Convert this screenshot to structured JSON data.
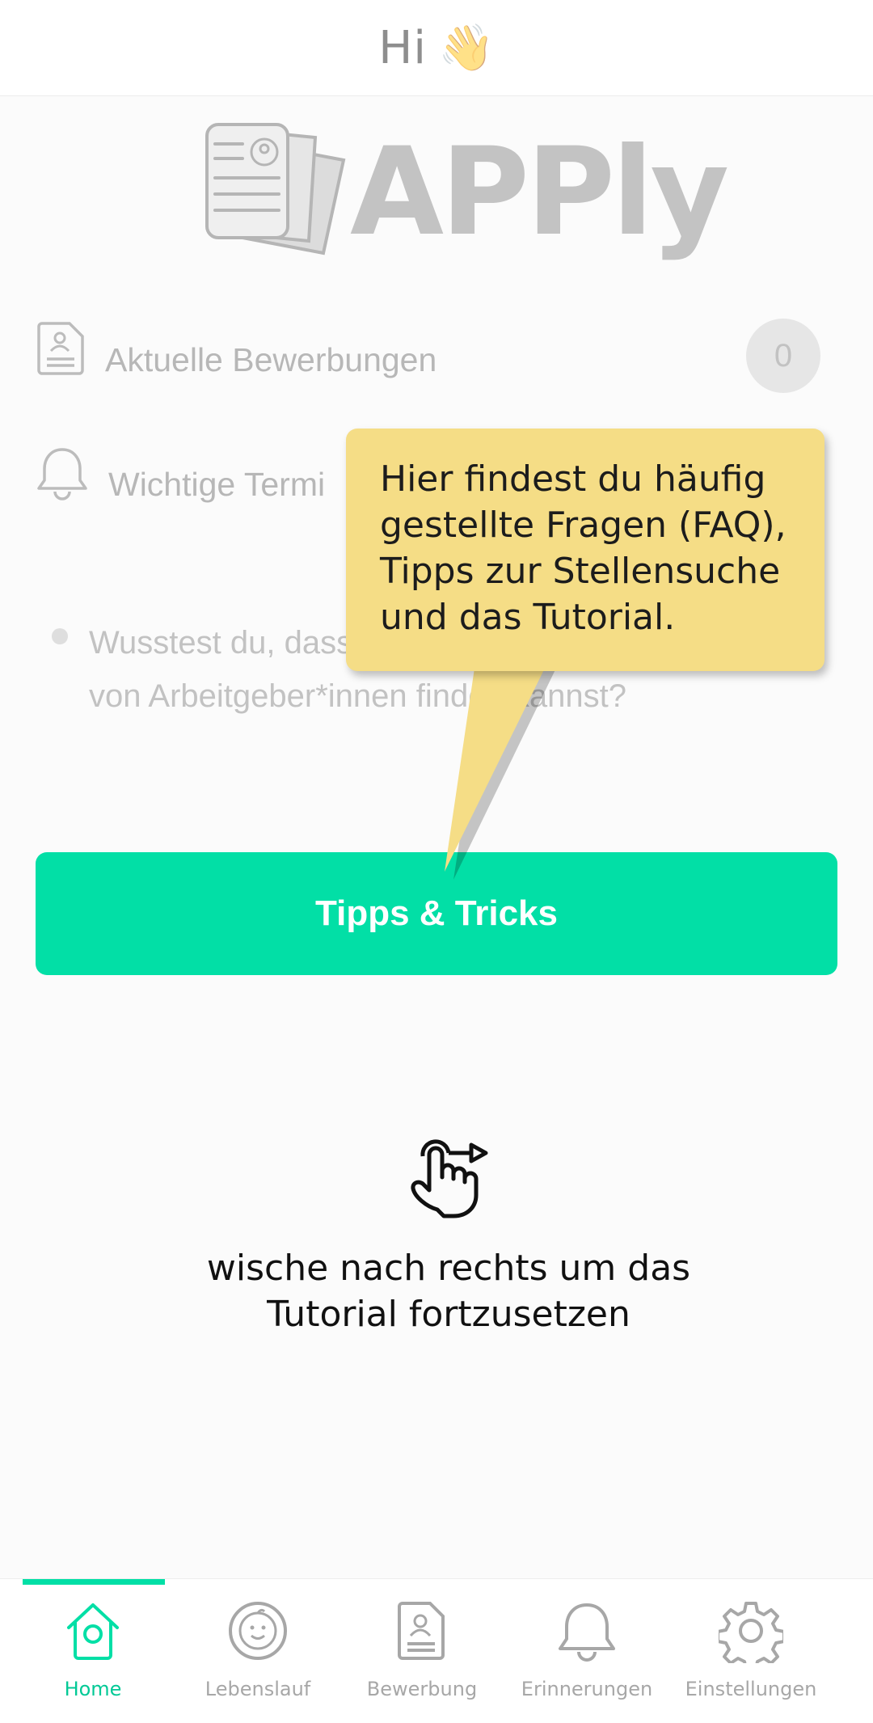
{
  "header": {
    "greeting": "Hi",
    "emoji": "👋"
  },
  "logo": {
    "wordmark": "APPly"
  },
  "dashboard": {
    "applications_label": "Aktuelle Bewerbungen",
    "applications_count": "0",
    "appointments_label": "Wichtige Termi"
  },
  "tip": {
    "text": "Wusstest du, dass du auf “Kununu” Bewertungen von Arbeitgeber*innen finden kannst?"
  },
  "tips_button": {
    "label": "Tipps & Tricks"
  },
  "tutorial": {
    "bubble_text": "Hier findest du häufig gestellte Fragen (FAQ), Tipps zur Stellensuche und das Tutorial.",
    "swipe_hint_line1": "wische nach rechts um das",
    "swipe_hint_line2": "Tutorial fortzusetzen"
  },
  "nav": {
    "items": [
      {
        "label": "Home",
        "icon": "home-icon",
        "active": true
      },
      {
        "label": "Lebenslauf",
        "icon": "face-icon",
        "active": false
      },
      {
        "label": "Bewerbung",
        "icon": "document-icon",
        "active": false
      },
      {
        "label": "Erinnerungen",
        "icon": "bell-icon",
        "active": false
      },
      {
        "label": "Einstellungen",
        "icon": "gear-icon",
        "active": false
      }
    ]
  },
  "colors": {
    "accent": "#02dfa6",
    "bubble": "#f5dd86",
    "muted_text": "#b7b7b7"
  }
}
